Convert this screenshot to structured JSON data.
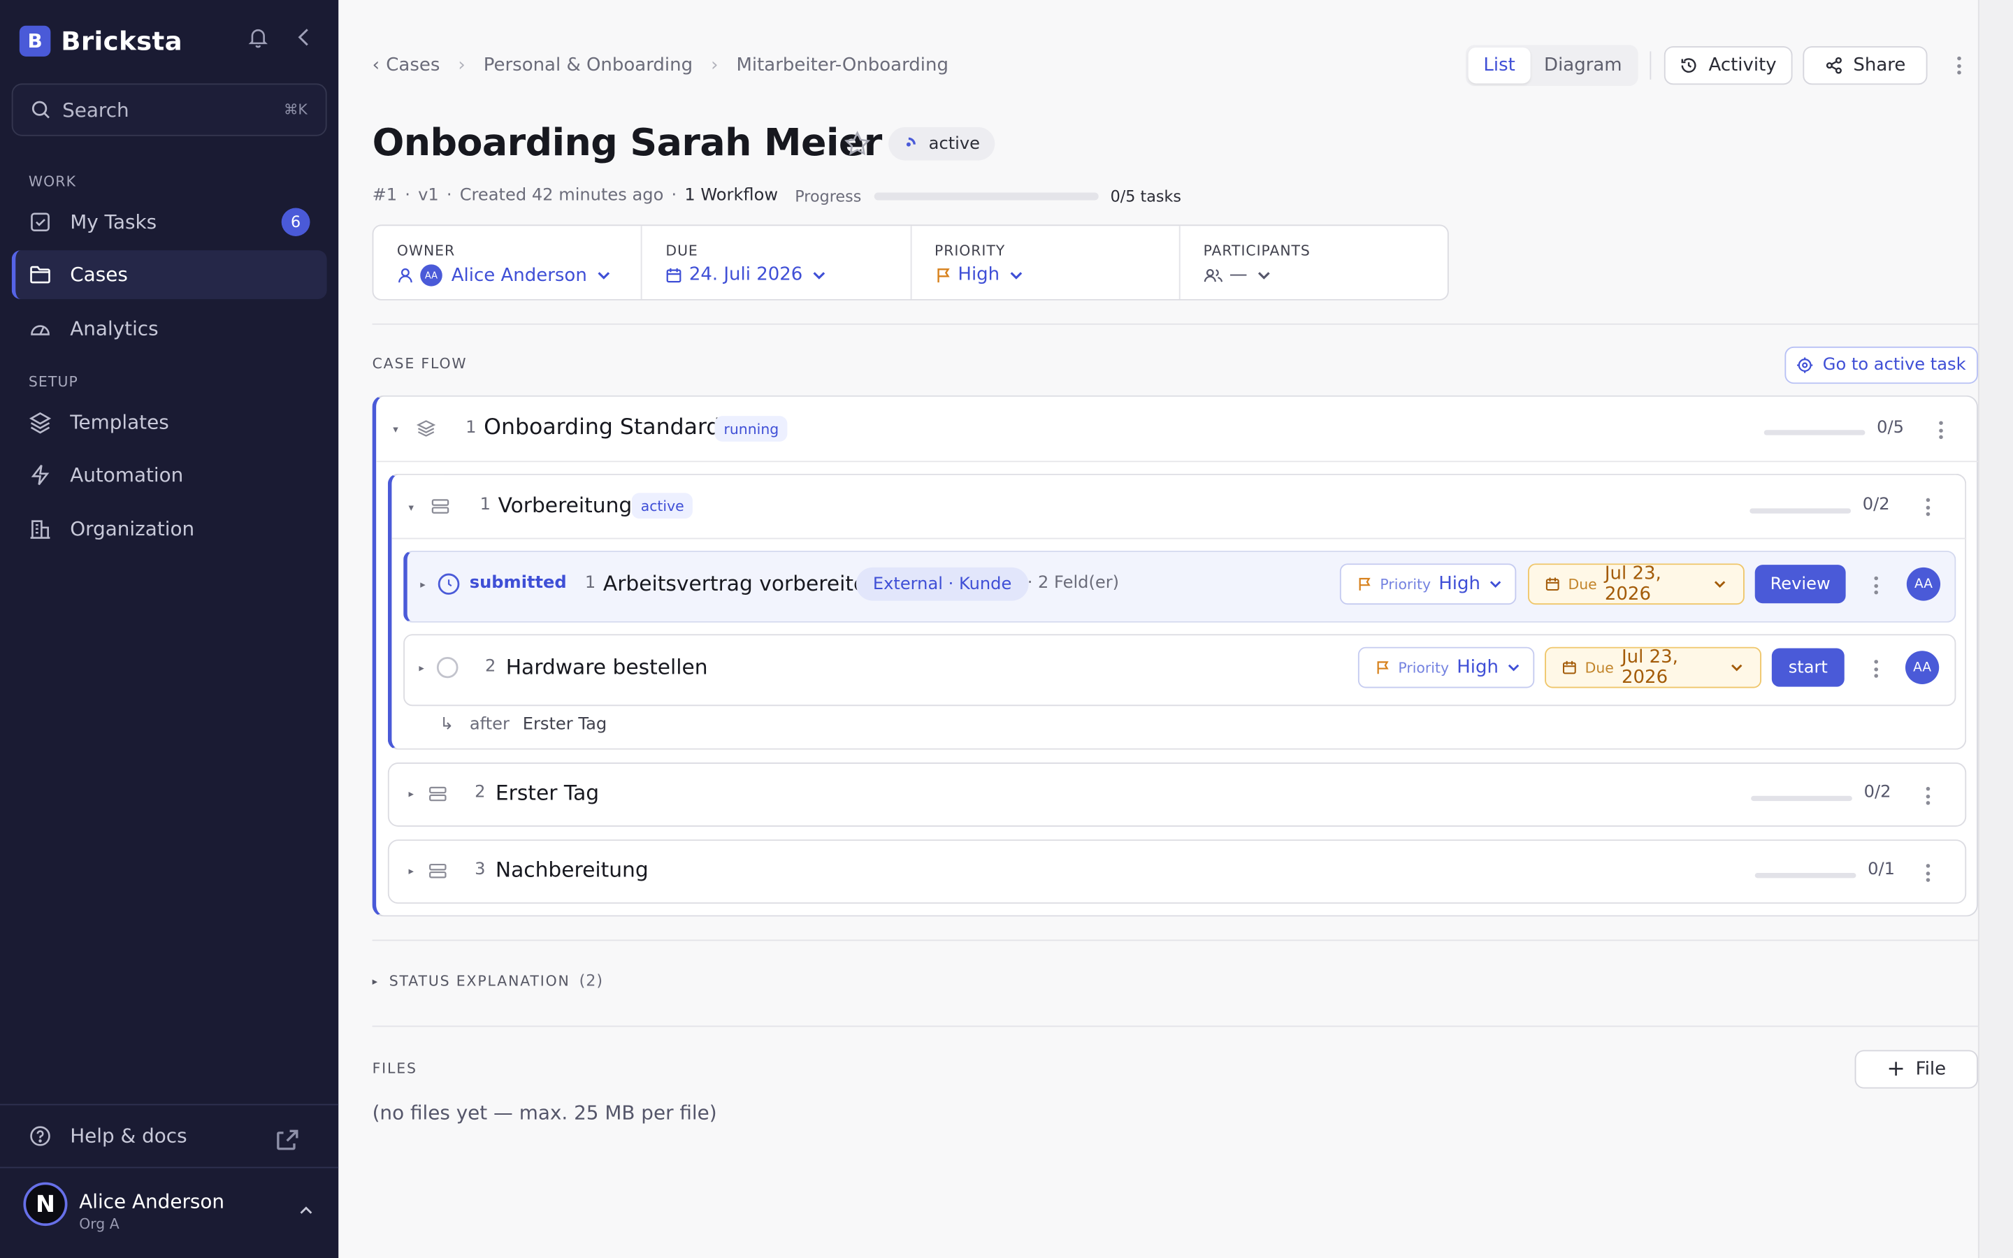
{
  "sidebar": {
    "brand": {
      "logo_letter": "B",
      "name": "Bricksta"
    },
    "search": {
      "label": "Search",
      "shortcut": "⌘K"
    },
    "sections": {
      "work": "WORK",
      "setup": "SETUP"
    },
    "work_items": [
      {
        "label": "My Tasks",
        "icon": "checkbox-icon",
        "badge": "6"
      },
      {
        "label": "Cases",
        "icon": "folder-icon",
        "active": true
      },
      {
        "label": "Analytics",
        "icon": "gauge-icon"
      }
    ],
    "setup_items": [
      {
        "label": "Templates",
        "icon": "layers-icon"
      },
      {
        "label": "Automation",
        "icon": "bolt-icon"
      },
      {
        "label": "Organization",
        "icon": "building-icon"
      }
    ],
    "help": "Help & docs",
    "user": {
      "initial": "N",
      "name": "Alice Anderson",
      "org": "Org A"
    }
  },
  "header": {
    "breadcrumbs": [
      "Cases",
      "Personal & Onboarding",
      "Mitarbeiter-Onboarding"
    ],
    "view_tabs": [
      {
        "label": "List",
        "selected": true
      },
      {
        "label": "Diagram",
        "selected": false
      }
    ],
    "activity_label": "Activity",
    "share_label": "Share"
  },
  "case": {
    "title": "Onboarding Sarah Meier",
    "status": "active",
    "meta": {
      "id": "#1",
      "version": "v1",
      "created": "Created 42 minutes ago",
      "workflows": "1 Workflow",
      "progress_label": "Progress",
      "progress_fraction": 0,
      "progress_text": "0/5 tasks"
    },
    "props": {
      "owner": {
        "label": "OWNER",
        "initials": "AA",
        "value": "Alice Anderson"
      },
      "due": {
        "label": "DUE",
        "value": "24. Juli 2026"
      },
      "priority": {
        "label": "PRIORITY",
        "value": "High"
      },
      "participants": {
        "label": "PARTICIPANTS",
        "value": "—"
      }
    }
  },
  "case_flow": {
    "title": "CASE FLOW",
    "go_active": "Go to active task",
    "workflow": {
      "num": "1",
      "name": "Onboarding Standard",
      "status": "running",
      "progress": "0/5"
    },
    "stages": [
      {
        "num": "1",
        "name": "Vorbereitung",
        "status": "active",
        "progress": "0/2"
      },
      {
        "num": "2",
        "name": "Erster Tag",
        "progress": "0/2"
      },
      {
        "num": "3",
        "name": "Nachbereitung",
        "progress": "0/1"
      }
    ],
    "tasks": [
      {
        "status": "submitted",
        "num": "1",
        "name": "Arbeitsvertrag vorbereiten",
        "tag": "External · Kunde",
        "fields": "· 2 Feld(er)",
        "priority_label": "Priority",
        "priority": "High",
        "due_label": "Due",
        "due": "Jul 23, 2026",
        "action": "Review",
        "assignee": "AA"
      },
      {
        "num": "2",
        "name": "Hardware bestellen",
        "priority_label": "Priority",
        "priority": "High",
        "due_label": "Due",
        "due": "Jul 23, 2026",
        "action": "start",
        "assignee": "AA",
        "after_label": "after",
        "after": "Erster Tag"
      }
    ]
  },
  "status_explanation": {
    "label": "STATUS EXPLANATION",
    "count": "(2)"
  },
  "files": {
    "title": "FILES",
    "add_label": "File",
    "empty": "(no files yet — max. 25 MB per file)"
  },
  "colors": {
    "accent": "#4a5ad8",
    "sidebar_bg": "#1a1b33",
    "due_bg": "#fff8e7",
    "due_text": "#a35b08"
  }
}
